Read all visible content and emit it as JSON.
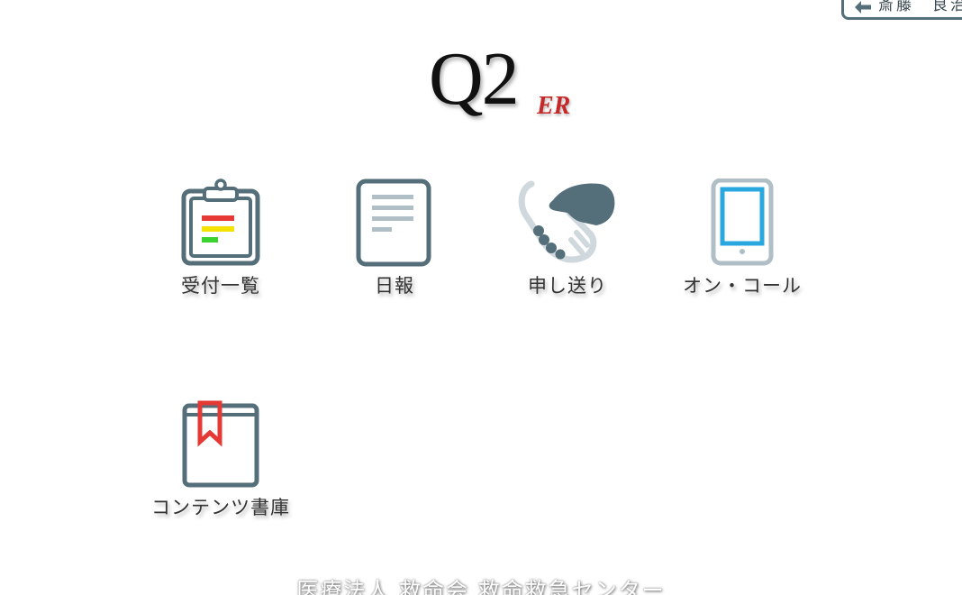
{
  "user": {
    "name": "斎藤　良治",
    "back_icon": "arrow-left-icon"
  },
  "logo": {
    "main": "Q2",
    "sub": "ER"
  },
  "menu": [
    {
      "label": "受付一覧",
      "icon": "clipboard-icon"
    },
    {
      "label": "日報",
      "icon": "document-icon"
    },
    {
      "label": "申し送り",
      "icon": "handshake-icon"
    },
    {
      "label": "オン・コール",
      "icon": "smartphone-icon"
    },
    {
      "label": "コンテンツ書庫",
      "icon": "book-icon"
    }
  ],
  "footer": {
    "text": "医療法人 救命会 救命救急センター"
  },
  "colors": {
    "icon_primary": "#546e7a",
    "icon_light": "#b0bec5",
    "accent_blue": "#29a8e0",
    "accent_red": "#e53935",
    "logo_red": "#c62828"
  }
}
